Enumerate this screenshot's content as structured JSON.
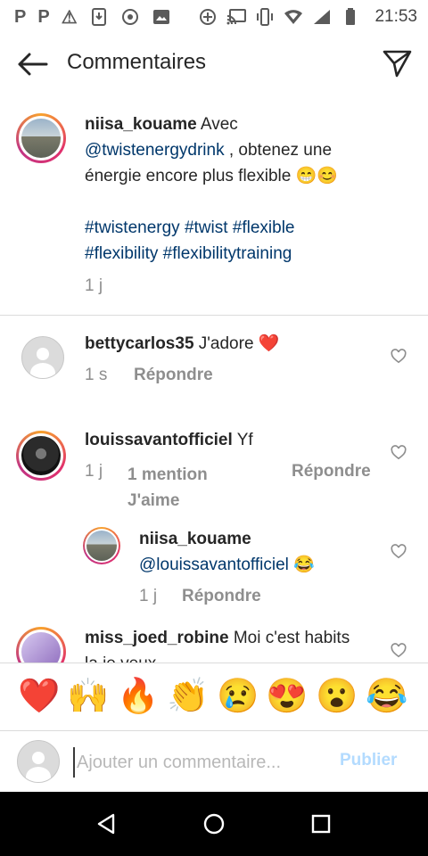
{
  "status_bar": {
    "left_icons": [
      "P",
      "P",
      "⚠"
    ],
    "time": "21:53"
  },
  "header": {
    "title": "Commentaires",
    "back_icon": "arrow-left-icon",
    "send_icon": "paper-plane-icon"
  },
  "post": {
    "username": "niisa_kouame",
    "text_part1": " Avec ",
    "mention": "@twistenergydrink",
    "text_part2": " , obtenez une énergie encore plus flexible 😁😊",
    "hashtags_line1": "#twistenergy #twist #flexible",
    "hashtags_line2": "#flexibility #flexibilitytraining",
    "time": "1 j"
  },
  "comments": [
    {
      "username": "bettycarlos35",
      "text": " J'adore ❤️",
      "time": "1 s",
      "reply": "Répondre"
    },
    {
      "username": "louissavantofficiel",
      "text": " Yf",
      "time": "1 j",
      "likes": "1 mention J'aime",
      "reply": "Répondre"
    },
    {
      "username": "niisa_kouame",
      "mention": "@louissavantofficiel",
      "emoji": " 😂",
      "time": "1 j",
      "reply": "Répondre"
    },
    {
      "username": "miss_joed_robine",
      "text": " Moi c'est habits",
      "text_line2": "la je veux"
    }
  ],
  "emoji_bar": [
    "❤️",
    "🙌",
    "🔥",
    "👏",
    "😢",
    "😍",
    "😮",
    "😂"
  ],
  "input": {
    "placeholder": "Ajouter un commentaire...",
    "publish": "Publier"
  }
}
